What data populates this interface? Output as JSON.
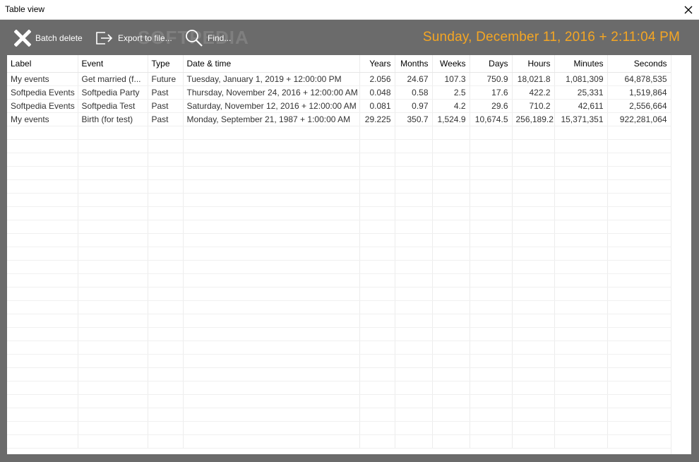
{
  "window": {
    "title": "Table view"
  },
  "toolbar": {
    "batch_delete": "Batch delete",
    "export": "Export to file...",
    "find": "Find...",
    "watermark": "SOFTPEDIA",
    "clock": "Sunday, December 11, 2016 + 2:11:04 PM",
    "clock_color": "#f5a623"
  },
  "table": {
    "columns": [
      "Label",
      "Event",
      "Type",
      "Date & time",
      "Years",
      "Months",
      "Weeks",
      "Days",
      "Hours",
      "Minutes",
      "Seconds"
    ],
    "rows": [
      [
        "My events",
        "Get married (f...",
        "Future",
        "Tuesday, January 1, 2019 + 12:00:00 PM",
        "2.056",
        "24.67",
        "107.3",
        "750.9",
        "18,021.8",
        "1,081,309",
        "64,878,535"
      ],
      [
        "Softpedia Events",
        "Softpedia Party",
        "Past",
        "Thursday, November 24, 2016 + 12:00:00 AM",
        "0.048",
        "0.58",
        "2.5",
        "17.6",
        "422.2",
        "25,331",
        "1,519,864"
      ],
      [
        "Softpedia Events",
        "Softpedia Test",
        "Past",
        "Saturday, November 12, 2016 + 12:00:00 AM",
        "0.081",
        "0.97",
        "4.2",
        "29.6",
        "710.2",
        "42,611",
        "2,556,664"
      ],
      [
        "My events",
        "Birth (for test)",
        "Past",
        "Monday, September 21, 1987 + 1:00:00 AM",
        "29.225",
        "350.7",
        "1,524.9",
        "10,674.5",
        "256,189.2",
        "15,371,351",
        "922,281,064"
      ]
    ]
  }
}
